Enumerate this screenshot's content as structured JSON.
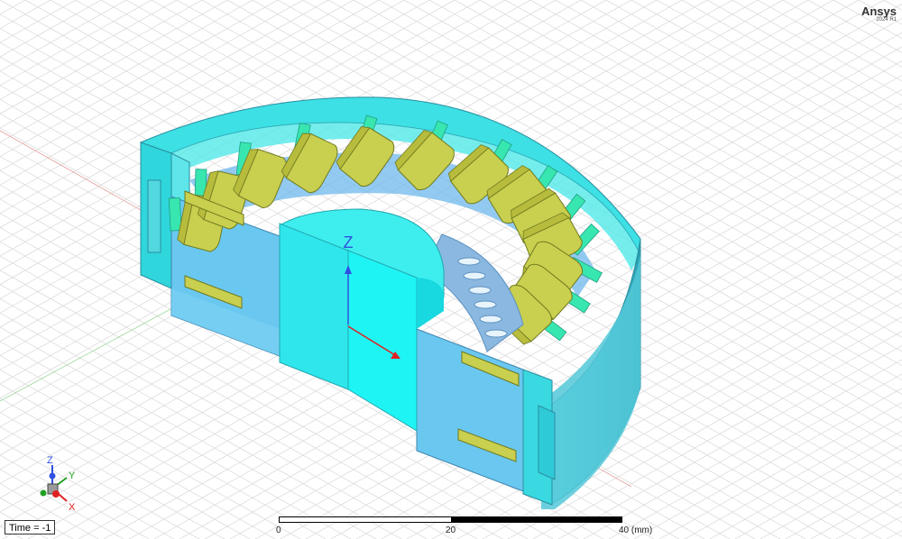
{
  "brand": {
    "name": "Ansys",
    "version": "2024 R1"
  },
  "status": {
    "time_label": "Time = -1"
  },
  "scale_bar": {
    "labels": [
      "0",
      "20",
      "40 (mm)"
    ]
  },
  "axes": {
    "center_label": "Z",
    "triad": {
      "z": "Z",
      "y": "Y",
      "x": "X"
    }
  },
  "colors": {
    "housing": "#3de0e4",
    "stator_core": "#6ac8f0",
    "coil": "#c9cf4e",
    "slot_liner": "#38e6b0",
    "shaft": "#22f0f0",
    "axis_x": "#e02020",
    "axis_y": "#20a020",
    "axis_z": "#3050e0"
  }
}
